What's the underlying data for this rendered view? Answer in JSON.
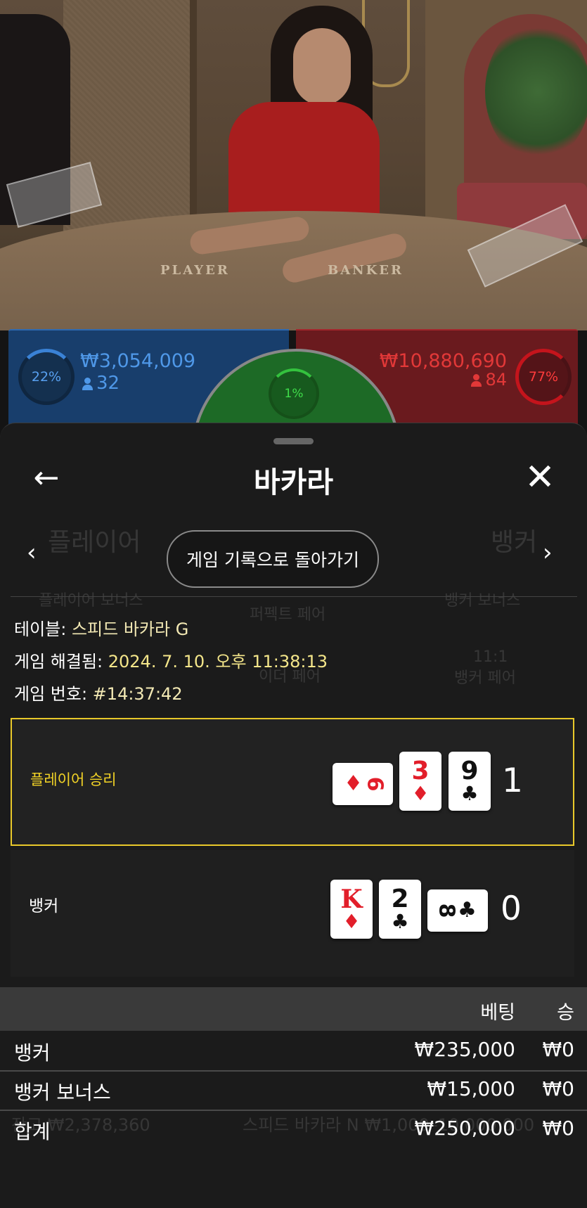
{
  "stream": {
    "table_labels": {
      "player": "PLAYER",
      "banker": "BANKER"
    }
  },
  "betting_bar": {
    "player": {
      "percent": "22%",
      "amount": "₩3,054,009",
      "count": "32",
      "color": "#4f98e8"
    },
    "tie": {
      "percent": "1%",
      "color": "#3fdc4a"
    },
    "banker": {
      "percent": "77%",
      "amount": "₩10,880,690",
      "count": "84",
      "color": "#e23838"
    }
  },
  "sheet": {
    "title": "바카라",
    "back_icon": "arrow-left-icon",
    "close_icon": "close-icon",
    "return_button": "게임 기록으로 돌아가기",
    "background_labels": {
      "player": "플레이어",
      "banker": "뱅커",
      "player_bonus": "플레이어 보너스",
      "perfect_pair": "퍼펙트 페어",
      "banker_bonus": "뱅커 보너스",
      "either_pair": "이더 페어",
      "banker_pair_odds": "11:1",
      "banker_pair": "뱅커 페어",
      "balance_row": "잔고 ₩2,378,360",
      "table_row": "스피드 바카라 N ₩1,000–10,000,000"
    },
    "info": {
      "table_label": "테이블:",
      "table_value": "스피드 바카라 G",
      "resolved_label": "게임 해결됨:",
      "resolved_value": "2024. 7. 10. 오후 11:38:13",
      "number_label": "게임 번호:",
      "number_value": "#14:37:42"
    },
    "results": [
      {
        "label": "플레이어 승리",
        "score": "1",
        "winner": true,
        "cards": [
          {
            "rank": "6",
            "suit": "♦",
            "color": "red",
            "orientation": "sideways"
          },
          {
            "rank": "3",
            "suit": "♦",
            "color": "red"
          },
          {
            "rank": "9",
            "suit": "♣",
            "color": "black"
          }
        ]
      },
      {
        "label": "뱅커",
        "score": "0",
        "winner": false,
        "cards": [
          {
            "rank": "K",
            "suit": "♦",
            "color": "red"
          },
          {
            "rank": "2",
            "suit": "♣",
            "color": "black"
          },
          {
            "rank": "8",
            "suit": "♣",
            "color": "black",
            "orientation": "sideways"
          }
        ]
      }
    ],
    "bets_table": {
      "header_bet": "베팅",
      "header_win": "승",
      "rows": [
        {
          "label": "뱅커",
          "bet": "₩235,000",
          "win": "₩0"
        },
        {
          "label": "뱅커 보너스",
          "bet": "₩15,000",
          "win": "₩0"
        },
        {
          "label": "합계",
          "bet": "₩250,000",
          "win": "₩0"
        }
      ]
    }
  },
  "colors": {
    "winner_border": "#e8c82a",
    "winner_label": "#f2d326",
    "info_value": "#f4e68a"
  }
}
